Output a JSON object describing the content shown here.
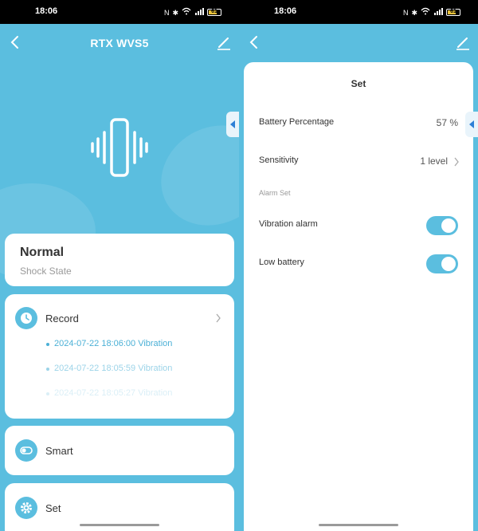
{
  "status_bar": {
    "time": "18:06",
    "battery": "61"
  },
  "left": {
    "nav": {
      "title": "RTX WVS5"
    },
    "state_card": {
      "state": "Normal",
      "label": "Shock State"
    },
    "record_card": {
      "title": "Record",
      "items": [
        "2024-07-22 18:06:00 Vibration",
        "2024-07-22 18:05:59 Vibration",
        "2024-07-22 18:05:27 Vibration"
      ]
    },
    "smart_card": {
      "title": "Smart"
    },
    "set_card": {
      "title": "Set"
    }
  },
  "right": {
    "sheet_title": "Set",
    "battery_row": {
      "label": "Battery Percentage",
      "value": "57 %"
    },
    "sensitivity_row": {
      "label": "Sensitivity",
      "value": "1 level"
    },
    "section_label": "Alarm Set",
    "vibration_row": {
      "label": "Vibration alarm",
      "enabled": true
    },
    "low_battery_row": {
      "label": "Low battery",
      "enabled": true
    }
  },
  "colors": {
    "accent": "#5bbedf",
    "record_text": "#4bb0d6"
  }
}
